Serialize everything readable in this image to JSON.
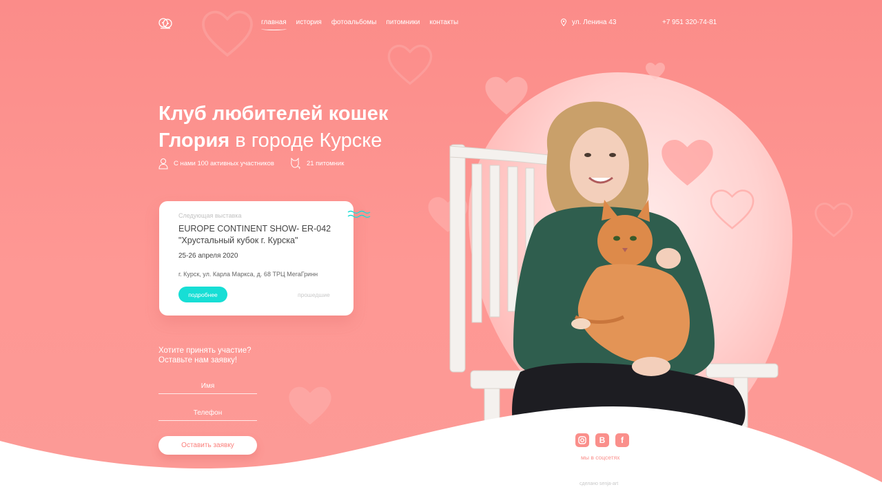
{
  "header": {
    "nav": [
      {
        "label": "главная",
        "active": true
      },
      {
        "label": "история",
        "active": false
      },
      {
        "label": "фотоальбомы",
        "active": false
      },
      {
        "label": "питомники",
        "active": false
      },
      {
        "label": "контакты",
        "active": false
      }
    ],
    "address": "ул. Ленина 43",
    "phone": "+7 951 320-74-81"
  },
  "hero": {
    "title_line1": "Клуб любителей кошек",
    "title_bold": "Глория",
    "title_light": " в городе Курске",
    "stat_members": "С нами 100 активных участников",
    "stat_nurseries": "21 питомник"
  },
  "event_card": {
    "label": "Следующая выставка",
    "title_line1": "EUROPE CONTINENT SHOW- ER-042",
    "title_line2": "\"Хрустальный кубок г. Курска\"",
    "date": "25-26 апреля 2020",
    "place": "г. Курск, ул. Карла Маркса, д. 68 ТРЦ МегаГринн",
    "more_button": "подробнее",
    "past_link": "прошедшие"
  },
  "form": {
    "title_line1": "Хотите принять участие?",
    "title_line2": "Оставьте нам заявку!",
    "name_placeholder": "Имя",
    "phone_placeholder": "Телефон",
    "submit": "Оставить заявку"
  },
  "footer": {
    "social_label": "мы в соцсетях",
    "credit": "сделано senja-art"
  },
  "colors": {
    "background": "#fb8c89",
    "accent": "#17ded5",
    "social": "#fa8f8b"
  }
}
